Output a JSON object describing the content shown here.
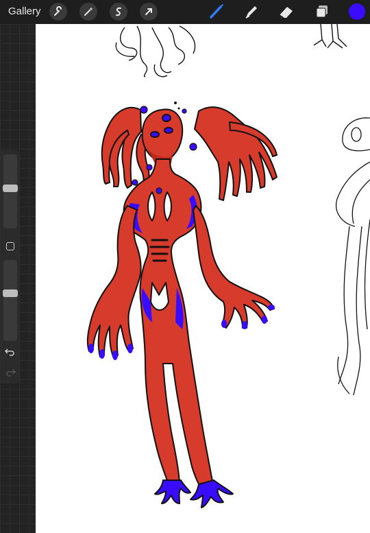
{
  "toolbar": {
    "gallery_label": "Gallery",
    "actions": [
      "wrench-icon",
      "magic-wand-icon",
      "selection-icon",
      "transform-arrow-icon"
    ],
    "tools": [
      "brush-icon",
      "smudge-icon",
      "eraser-icon",
      "layers-icon"
    ],
    "active_tool": "brush-icon",
    "current_color": "#3a0cff",
    "accent_color": "#2f7cf6"
  },
  "sidebar": {
    "brush_size_level": 0.55,
    "opacity_level": 0.6,
    "icons": [
      "modify-button-icon",
      "undo-icon",
      "redo-icon"
    ]
  },
  "artwork": {
    "body_color": "#d63b2c",
    "shade_color": "#3a0cff",
    "line_color": "#000000"
  }
}
